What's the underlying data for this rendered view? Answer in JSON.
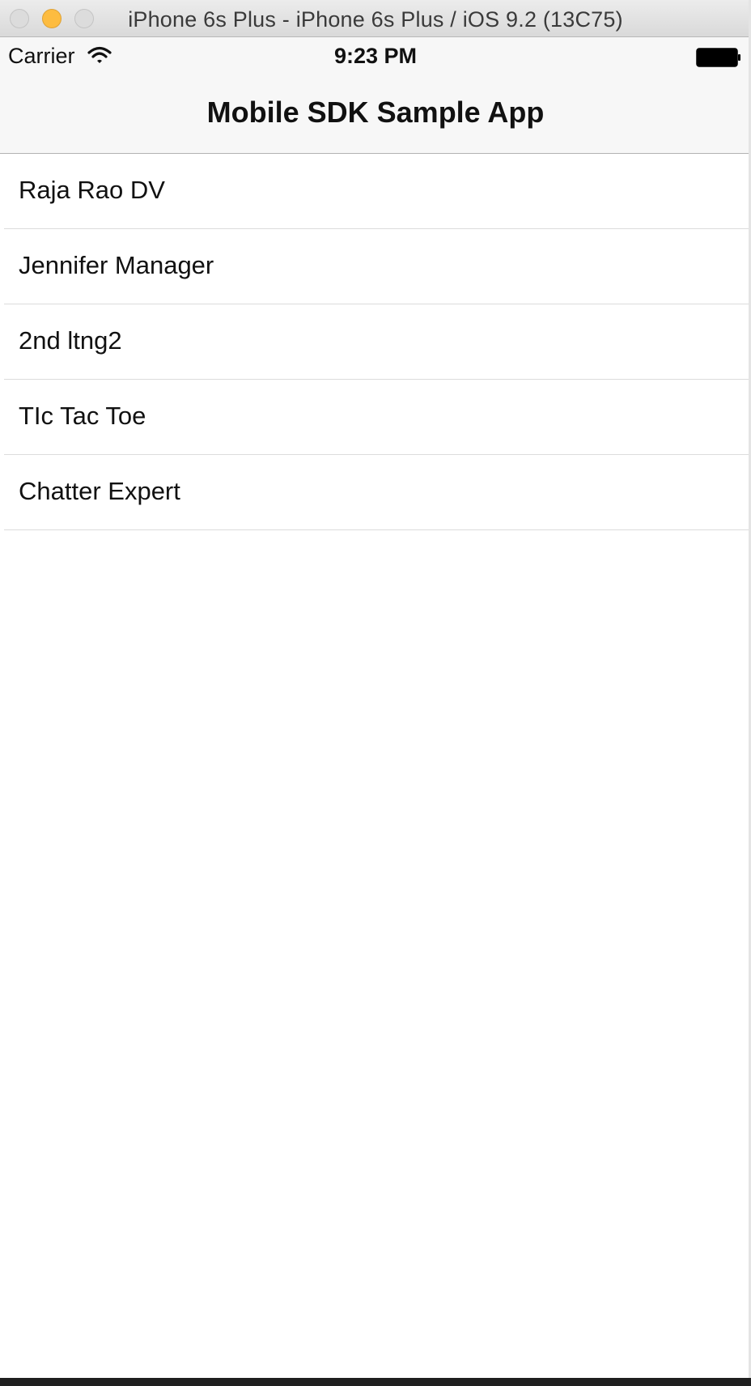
{
  "window": {
    "title": "iPhone 6s Plus - iPhone 6s Plus / iOS 9.2 (13C75)"
  },
  "status_bar": {
    "carrier": "Carrier",
    "time": "9:23 PM",
    "wifi_icon": "wifi-icon",
    "battery_icon": "battery-icon"
  },
  "nav_bar": {
    "title": "Mobile SDK Sample App"
  },
  "list": {
    "items": [
      {
        "label": "Raja Rao DV"
      },
      {
        "label": "Jennifer Manager"
      },
      {
        "label": "2nd ltng2"
      },
      {
        "label": "TIc Tac Toe"
      },
      {
        "label": "Chatter Expert"
      }
    ]
  },
  "colors": {
    "minimize_button": "#fdbc40",
    "nav_background": "#f7f7f7",
    "separator": "#dcdcdc"
  }
}
